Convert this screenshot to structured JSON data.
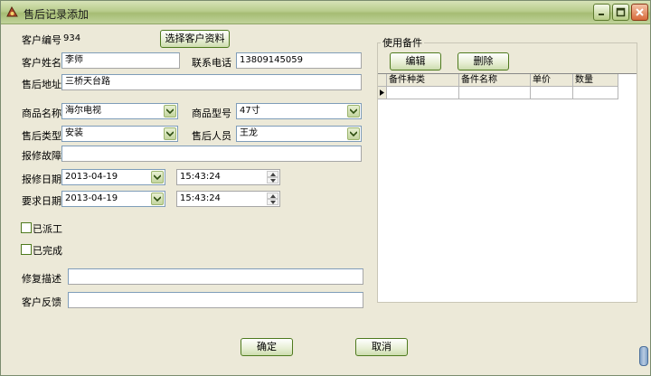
{
  "window": {
    "title": "售后记录添加"
  },
  "form": {
    "customer_no_label": "客户编号",
    "customer_no_value": "934",
    "select_customer_button": "选择客户资料",
    "customer_name_label": "客户姓名",
    "customer_name_value": "李师",
    "phone_label": "联系电话",
    "phone_value": "13809145059",
    "address_label": "售后地址",
    "address_value": "三桥天台路",
    "product_name_label": "商品名称",
    "product_name_value": "海尔电视",
    "product_model_label": "商品型号",
    "product_model_value": "47寸",
    "service_type_label": "售后类型",
    "service_type_value": "安装",
    "service_person_label": "售后人员",
    "service_person_value": "王龙",
    "fault_label": "报修故障",
    "fault_value": "",
    "report_date_label": "报修日期",
    "report_date_value": "2013-04-19",
    "report_time_value": "15:43:24",
    "required_date_label": "要求日期",
    "required_date_value": "2013-04-19",
    "required_time_value": "15:43:24",
    "dispatched_label": "已派工",
    "completed_label": "已完成",
    "repair_desc_label": "修复描述",
    "repair_desc_value": "",
    "feedback_label": "客户反馈",
    "feedback_value": ""
  },
  "parts": {
    "group_title": "使用备件",
    "edit_button": "编辑",
    "delete_button": "删除",
    "columns": [
      "备件种类",
      "备件名称",
      "单价",
      "数量"
    ]
  },
  "footer": {
    "ok_button": "确定",
    "cancel_button": "取消"
  }
}
